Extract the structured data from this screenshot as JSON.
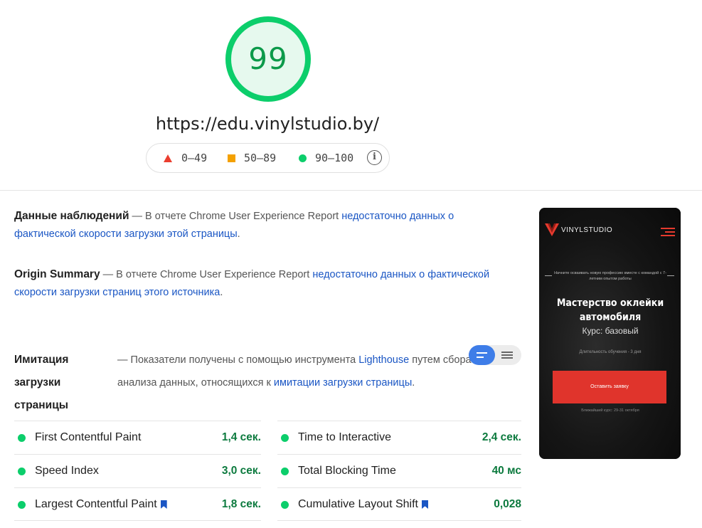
{
  "score": {
    "value": "99",
    "color": "#0cce6b",
    "url": "https://edu.vinylstudio.by/"
  },
  "legend": {
    "fail": "0–49",
    "average": "50–89",
    "pass": "90–100",
    "info_icon": "info-icon"
  },
  "field_data": {
    "title": "Данные наблюдений",
    "dash_text": " — В отчете Chrome User Experience Report ",
    "link_text": "недостаточно данных о фактической скорости загрузки этой страницы",
    "end": "."
  },
  "origin_summary": {
    "title": "Origin Summary",
    "dash_text": " — В отчете Chrome User Experience Report ",
    "link_text": "недостаточно данных о фактической скорости загрузки страниц этого источника",
    "end": "."
  },
  "lab_data": {
    "title": "Имитация загрузки страницы",
    "text_before": "— Показатели получены с помощью инструмента ",
    "link1": "Lighthouse",
    "text_middle": " путем сбора и анализа данных, относящихся к ",
    "link2": "имитации загрузки страницы",
    "end": "."
  },
  "metrics": [
    {
      "name": "First Contentful Paint",
      "value": "1,4 сек.",
      "status": "pass",
      "bookmark": false
    },
    {
      "name": "Time to Interactive",
      "value": "2,4 сек.",
      "status": "pass",
      "bookmark": false
    },
    {
      "name": "Speed Index",
      "value": "3,0 сек.",
      "status": "pass",
      "bookmark": false
    },
    {
      "name": "Total Blocking Time",
      "value": "40 мс",
      "status": "pass",
      "bookmark": false
    },
    {
      "name": "Largest Contentful Paint",
      "value": "1,8 сек.",
      "status": "pass",
      "bookmark": true
    },
    {
      "name": "Cumulative Layout Shift",
      "value": "0,028",
      "status": "pass",
      "bookmark": true
    }
  ],
  "screenshot": {
    "logo": "VINYLSTUDIO",
    "tagline": "Начните осваивать новую профессию вместе с командой с 7-летним опытом работы",
    "heading": "Мастерство оклейки автомобиля",
    "subheading": "Курс: базовый",
    "duration": "Длительность обучения - 3 дня",
    "button": "Оставить заявку",
    "footer": "Ближайший курс: 29-31 октября",
    "accent": "#e0342c"
  },
  "colors": {
    "pass": "#0cce6b",
    "average": "#f4a100",
    "fail": "#eb3e2f",
    "link": "#1a56c4",
    "toggle": "#3e7de8"
  }
}
